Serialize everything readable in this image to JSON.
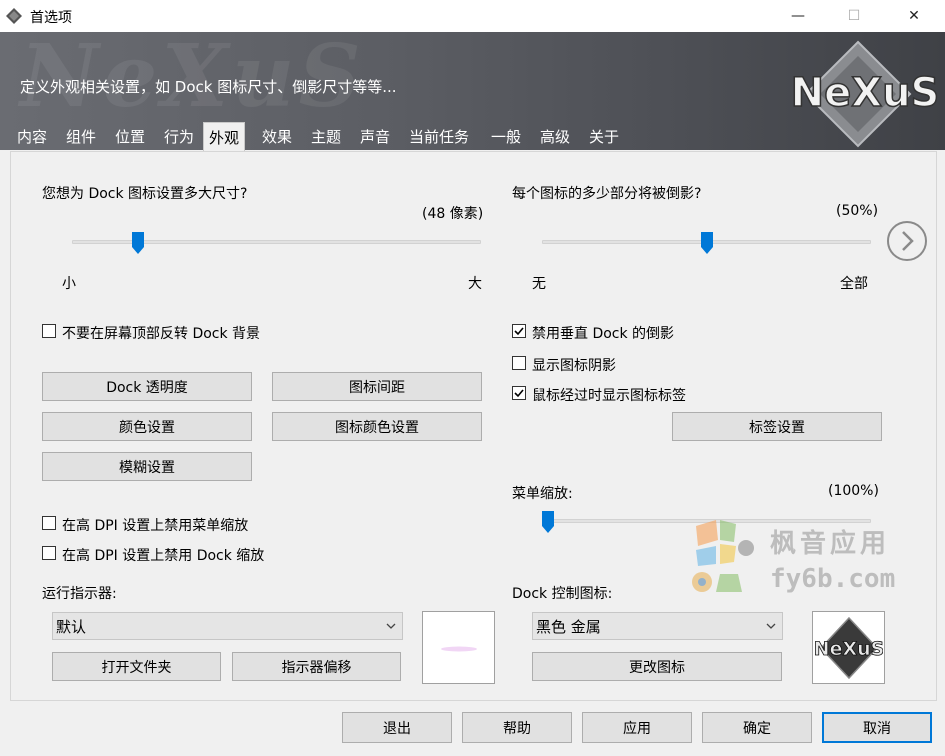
{
  "window": {
    "title": "首选项",
    "minimize_glyph": "—",
    "maximize_glyph": "☐",
    "close_glyph": "✕"
  },
  "banner": {
    "description": "定义外观相关设置，如 Dock 图标尺寸、倒影尺寸等等...",
    "watermark_text": "NeXuS",
    "logo_text": "NeXuS"
  },
  "tabs": [
    {
      "label": "内容"
    },
    {
      "label": "组件"
    },
    {
      "label": "位置"
    },
    {
      "label": "行为"
    },
    {
      "label": "外观",
      "active": true
    },
    {
      "label": "效果"
    },
    {
      "label": "主题"
    },
    {
      "label": "声音"
    },
    {
      "label": "当前任务"
    },
    {
      "label": "一般"
    },
    {
      "label": "高级"
    },
    {
      "label": "关于"
    }
  ],
  "icon_size": {
    "question": "您想为 Dock 图标设置多大尺寸?",
    "value_text": "(48 像素)",
    "min_label": "小",
    "max_label": "大",
    "level": 0.15
  },
  "reflection": {
    "question": "每个图标的多少部分将被倒影?",
    "value_text": "(50%)",
    "min_label": "无",
    "max_label": "全部",
    "level": 0.5
  },
  "left_options": {
    "no_flip_top": {
      "label": "不要在屏幕顶部反转 Dock 背景",
      "checked": false
    }
  },
  "right_options": {
    "disable_vertical_reflection": {
      "label": "禁用垂直 Dock 的倒影",
      "checked": true
    },
    "show_icon_shadow": {
      "label": "显示图标阴影",
      "checked": false
    },
    "show_labels_on_hover": {
      "label": "鼠标经过时显示图标标签",
      "checked": true
    }
  },
  "buttons": {
    "dock_transparency": "Dock 透明度",
    "icon_spacing": "图标间距",
    "color_settings": "颜色设置",
    "icon_color_settings": "图标颜色设置",
    "blur_settings": "模糊设置",
    "label_settings": "标签设置",
    "open_folder": "打开文件夹",
    "indicator_offset": "指示器偏移",
    "change_icon": "更改图标"
  },
  "menu_zoom": {
    "label": "菜单缩放:",
    "value_text": "(100%)",
    "level": 0.0
  },
  "dpi_options": {
    "disable_menu_zoom": {
      "label": "在高 DPI 设置上禁用菜单缩放",
      "checked": false
    },
    "disable_dock_zoom": {
      "label": "在高 DPI 设置上禁用 Dock 缩放",
      "checked": false
    }
  },
  "running_indicator": {
    "label": "运行指示器:",
    "selected": "默认"
  },
  "dock_control_icon": {
    "label": "Dock 控制图标:",
    "selected": "黑色 金属",
    "logo_text": "NeXuS"
  },
  "footer": {
    "exit": "退出",
    "help": "帮助",
    "apply": "应用",
    "ok": "确定",
    "cancel": "取消"
  },
  "site_watermark": {
    "line1": "枫音应用",
    "line2": "fy6b.com"
  },
  "colors": {
    "accent": "#0078d7",
    "banner_dark": "#3f4146",
    "check": "#000000"
  }
}
